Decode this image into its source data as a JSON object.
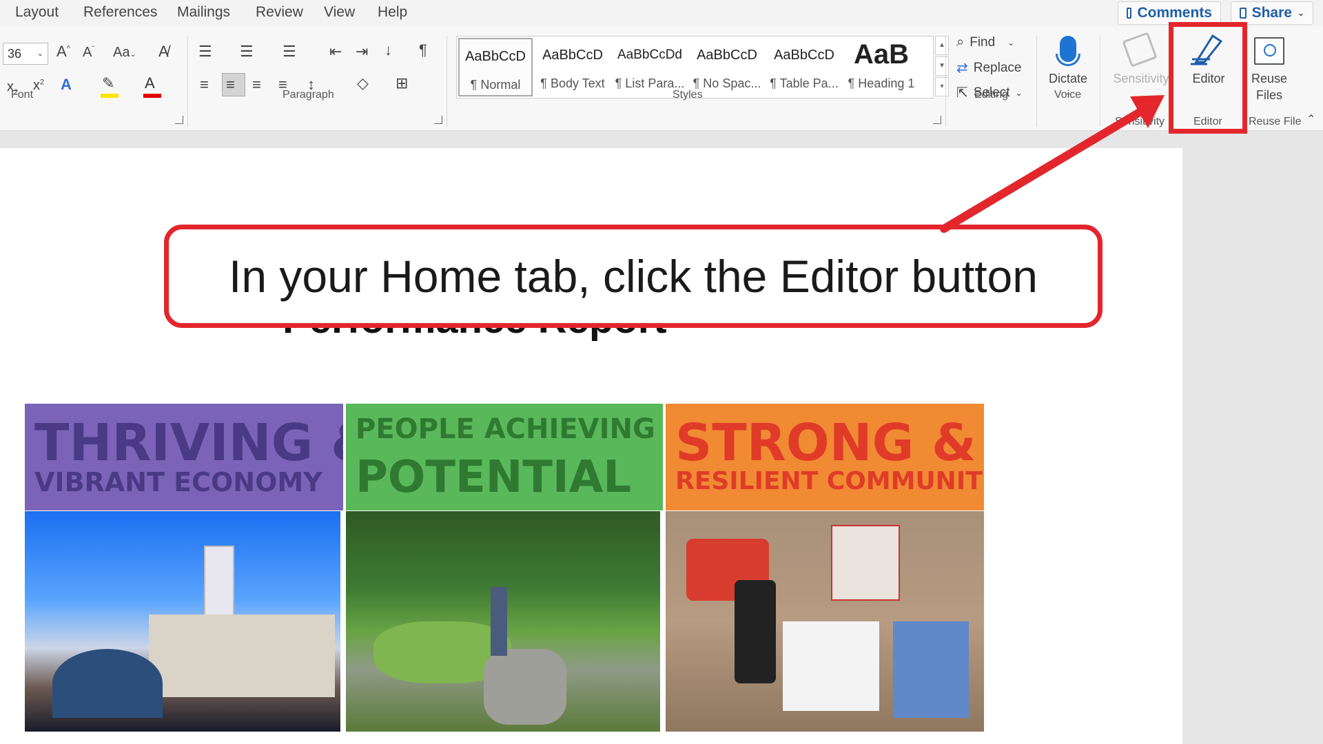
{
  "tabs": [
    "Layout",
    "References",
    "Mailings",
    "Review",
    "View",
    "Help"
  ],
  "top_buttons": {
    "comments": "Comments",
    "share": "Share"
  },
  "font": {
    "size": "36",
    "group_label": "Font"
  },
  "paragraph": {
    "group_label": "Paragraph"
  },
  "styles": {
    "group_label": "Styles",
    "items": [
      {
        "sample": "AaBbCcD",
        "name": "¶ Normal"
      },
      {
        "sample": "AaBbCcD",
        "name": "¶ Body Text"
      },
      {
        "sample": "AaBbCcDd",
        "name": "¶ List Para..."
      },
      {
        "sample": "AaBbCcD",
        "name": "¶ No Spac..."
      },
      {
        "sample": "AaBbCcD",
        "name": "¶ Table Pa..."
      },
      {
        "sample": "AaB",
        "name": "¶ Heading 1"
      }
    ]
  },
  "editing": {
    "find": "Find",
    "replace": "Replace",
    "select": "Select",
    "group_label": "Editing"
  },
  "voice": {
    "dictate": "Dictate",
    "group_label": "Voice"
  },
  "sensitivity": {
    "label": "Sensitivity",
    "group_label": "Sensitivity"
  },
  "editor": {
    "label": "Editor",
    "group_label": "Editor"
  },
  "reuse_files": {
    "label_line1": "Reuse",
    "label_line2": "Files",
    "group_label": "Reuse Files"
  },
  "document": {
    "title_partial": "Performance Report",
    "banners": [
      {
        "line1": "THRIVING &",
        "line2": "VIBRANT ECONOMY",
        "color": "#7b63b8"
      },
      {
        "line1": "PEOPLE ACHIEVING THEIR",
        "line2": "POTENTIAL",
        "color": "#58b85a"
      },
      {
        "line1": "STRONG &",
        "line2": "RESILIENT COMMUNITIES",
        "color": "#f08a33"
      }
    ]
  },
  "callout": {
    "text": "In your Home tab, click the Editor button"
  },
  "colors": {
    "accent_red": "#e3262c",
    "word_blue": "#1e5fa8"
  }
}
